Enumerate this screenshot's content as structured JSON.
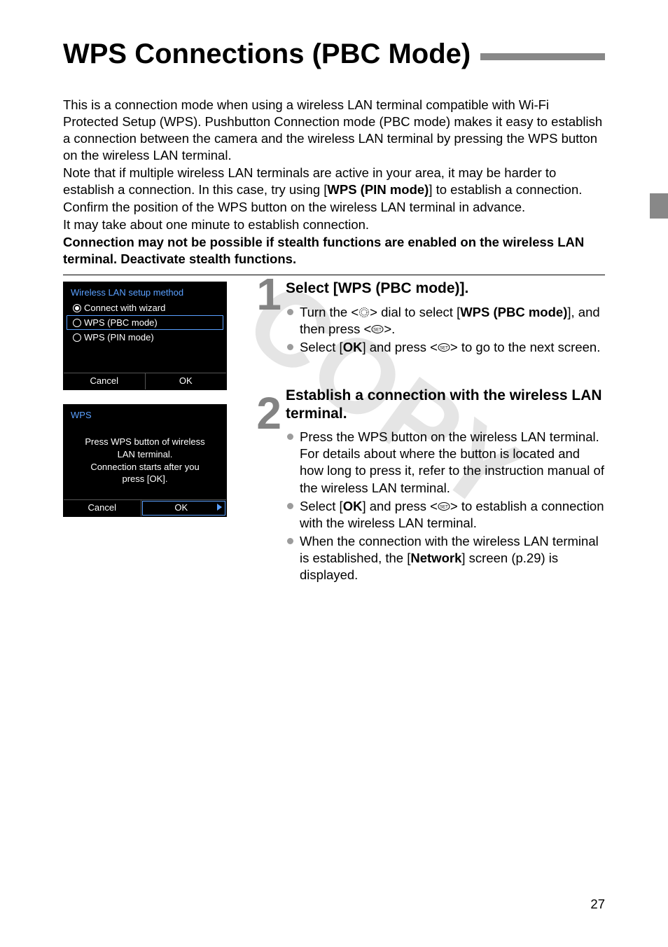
{
  "page_number": "27",
  "title": "WPS Connections (PBC Mode)",
  "intro": {
    "p1": "This is a connection mode when using a wireless LAN terminal compatible with Wi-Fi Protected Setup (WPS). Pushbutton Connection mode (PBC mode) makes it easy to establish a connection between the camera and the wireless LAN terminal by pressing the WPS button on the wireless LAN terminal.",
    "p2_a": "Note that if multiple wireless LAN terminals are active in your area, it may be harder to establish a connection. In this case, try using [",
    "p2_bold": "WPS (PIN mode)",
    "p2_b": "] to establish a connection.",
    "p3": "Confirm the position of the WPS button on the wireless LAN terminal in advance.",
    "p4": "It may take about one minute to establish connection.",
    "bold1": "Connection may not be possible if stealth functions are enabled on the wireless LAN terminal. Deactivate stealth functions."
  },
  "watermark": "COPY",
  "screen1": {
    "header": "Wireless LAN setup method",
    "opt1": "Connect with wizard",
    "opt2": "WPS (PBC mode)",
    "opt3": "WPS (PIN mode)",
    "cancel": "Cancel",
    "ok": "OK"
  },
  "screen2": {
    "header": "WPS",
    "msg": "Press WPS button of wireless LAN terminal. Connection starts after you press [OK].",
    "cancel": "Cancel",
    "ok": "OK"
  },
  "steps": [
    {
      "num": "1",
      "title": "Select [WPS (PBC mode)].",
      "bullets": [
        {
          "pre": "Turn the <",
          "icon": "dial",
          "mid": "> dial to select [",
          "bold": "WPS (PBC mode)",
          "post": "], and then press <",
          "icon2": "set",
          "post2": ">."
        },
        {
          "pre": "Select [",
          "bold": "OK",
          "mid": "] and press <",
          "icon": "set",
          "post": "> to go to the next screen."
        }
      ]
    },
    {
      "num": "2",
      "title": "Establish a connection with the wireless LAN terminal.",
      "bullets": [
        {
          "text": "Press the WPS button on the wireless LAN terminal. For details about where the button is located and how long to press it, refer to the instruction manual of the wireless LAN terminal."
        },
        {
          "pre": "Select [",
          "bold": "OK",
          "mid": "] and press <",
          "icon": "set",
          "post": "> to establish a connection with the wireless LAN terminal."
        },
        {
          "pre": "When the connection with the wireless LAN terminal is established, the [",
          "bold": "Network",
          "post": "] screen (p.29) is displayed."
        }
      ]
    }
  ]
}
